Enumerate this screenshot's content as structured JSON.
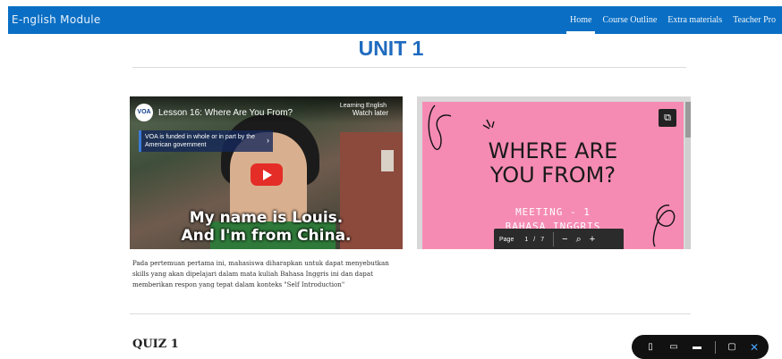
{
  "header": {
    "brand": "E-nglish Module",
    "nav": [
      {
        "label": "Home",
        "active": true
      },
      {
        "label": "Course Outline",
        "active": false
      },
      {
        "label": "Extra materials",
        "active": false
      },
      {
        "label": "Teacher Pro",
        "active": false
      }
    ],
    "accent_color": "#0a6fc4"
  },
  "page_title": "UNIT 1",
  "video": {
    "channel_logo": "VOA",
    "title": "Lesson 16: Where Are You From?",
    "brand": "Learning English",
    "watch_later": "Watch later",
    "notice": "VOA is funded in whole or in part by the American government",
    "caption_line1": "My name is Louis.",
    "caption_line2": "And I'm from China."
  },
  "slide": {
    "title_line1": "WHERE ARE",
    "title_line2": "YOU FROM?",
    "meeting": "MEETING - 1",
    "subtitle": "BAHASA INGGRIS",
    "background_color": "#f58bb3",
    "pager": {
      "label": "Page",
      "current": "1",
      "separator": "/",
      "total": "7",
      "zoom_out": "−",
      "zoom": "⌕",
      "zoom_in": "+"
    },
    "popout_icon": "external-link-icon"
  },
  "description": "Pada pertemuan pertama ini, mahasiswa diharapkan untuk dapat menyebutkan skills yang akan dipelajari dalam mata kuliah Bahasa Inggris ini dan dapat memberikan respon yang tepat dalam konteks \"Self Introduction\"",
  "quiz": {
    "title": "QUIZ 1"
  },
  "view_toolbar": {
    "icons": [
      "phone-view-icon",
      "tablet-view-icon",
      "laptop-view-icon",
      "comment-icon",
      "close-icon"
    ]
  }
}
